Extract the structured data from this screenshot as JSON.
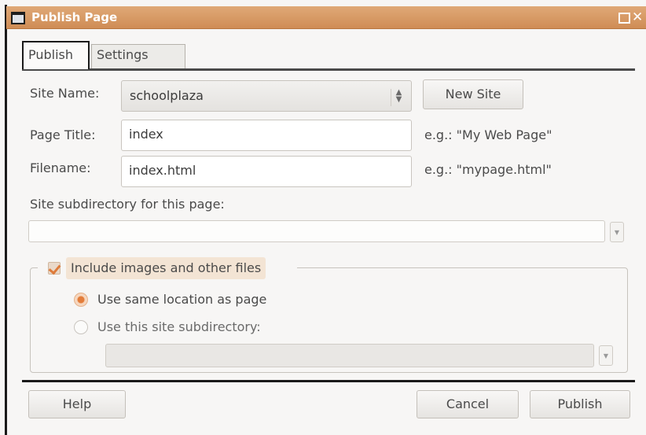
{
  "window": {
    "title": "Publish Page",
    "maximize_icon": "maximize-icon",
    "close_glyph": "✕"
  },
  "tabs": [
    {
      "label": "Publish",
      "active": true
    },
    {
      "label": "Settings",
      "active": false
    }
  ],
  "form": {
    "site_name_label": "Site Name:",
    "site_name_value": "schoolplaza",
    "new_site_label": "New Site",
    "page_title_label": "Page Title:",
    "page_title_value": "index",
    "page_title_hint": "e.g.: \"My Web Page\"",
    "filename_label": "Filename:",
    "filename_value": "index.html",
    "filename_hint": "e.g.: \"mypage.html\"",
    "subdirectory_label": "Site subdirectory for this page:",
    "subdirectory_value": ""
  },
  "files_group": {
    "checkbox_label": "Include images and other files",
    "checked": true,
    "option_same_location": "Use same location as page",
    "option_subdirectory": "Use this site subdirectory:",
    "selected_option": "same_location",
    "subdirectory_value": ""
  },
  "footer": {
    "help_label": "Help",
    "cancel_label": "Cancel",
    "publish_label": "Publish"
  },
  "colors": {
    "titlebar": "#d7955c",
    "accent": "#e37d3a"
  }
}
